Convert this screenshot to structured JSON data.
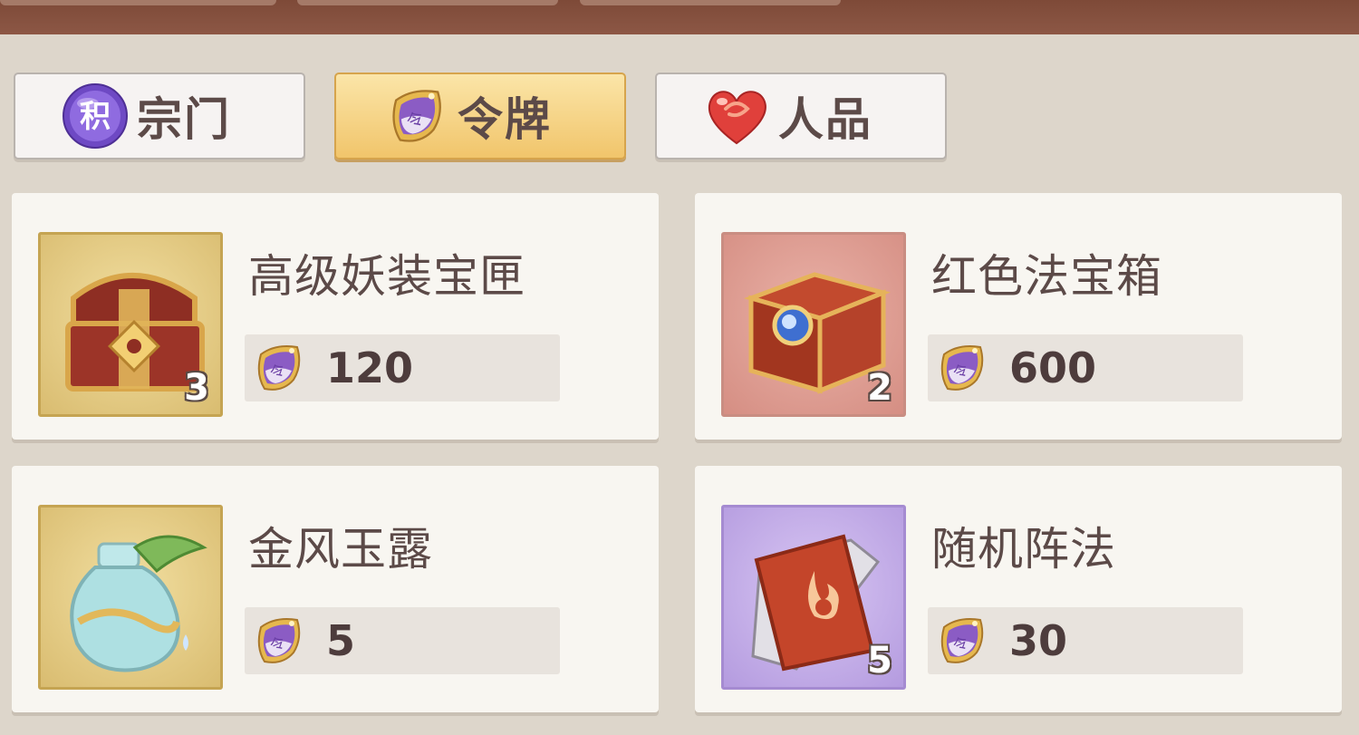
{
  "tabs": [
    {
      "label": "宗门",
      "icon": "points-orb-icon",
      "icon_text": "积",
      "active": false
    },
    {
      "label": "令牌",
      "icon": "token-plaque-icon",
      "active": true
    },
    {
      "label": "人品",
      "icon": "heart-icon",
      "active": false
    }
  ],
  "items": [
    {
      "name": "高级妖装宝匣",
      "price": "120",
      "quantity": "3",
      "icon": "ornate-treasure-chest-icon",
      "frame": "gold"
    },
    {
      "name": "红色法宝箱",
      "price": "600",
      "quantity": "2",
      "icon": "red-treasure-box-icon",
      "frame": "red"
    },
    {
      "name": "金风玉露",
      "price": "5",
      "quantity": "",
      "icon": "potion-bottle-icon",
      "frame": "gold"
    },
    {
      "name": "随机阵法",
      "price": "30",
      "quantity": "5",
      "icon": "fire-spellbook-icon",
      "frame": "purple"
    }
  ],
  "currency_icon": "token-plaque-icon",
  "colors": {
    "active_tab": "#f1c56b",
    "text": "#5c4a48",
    "header": "#8c5745"
  }
}
